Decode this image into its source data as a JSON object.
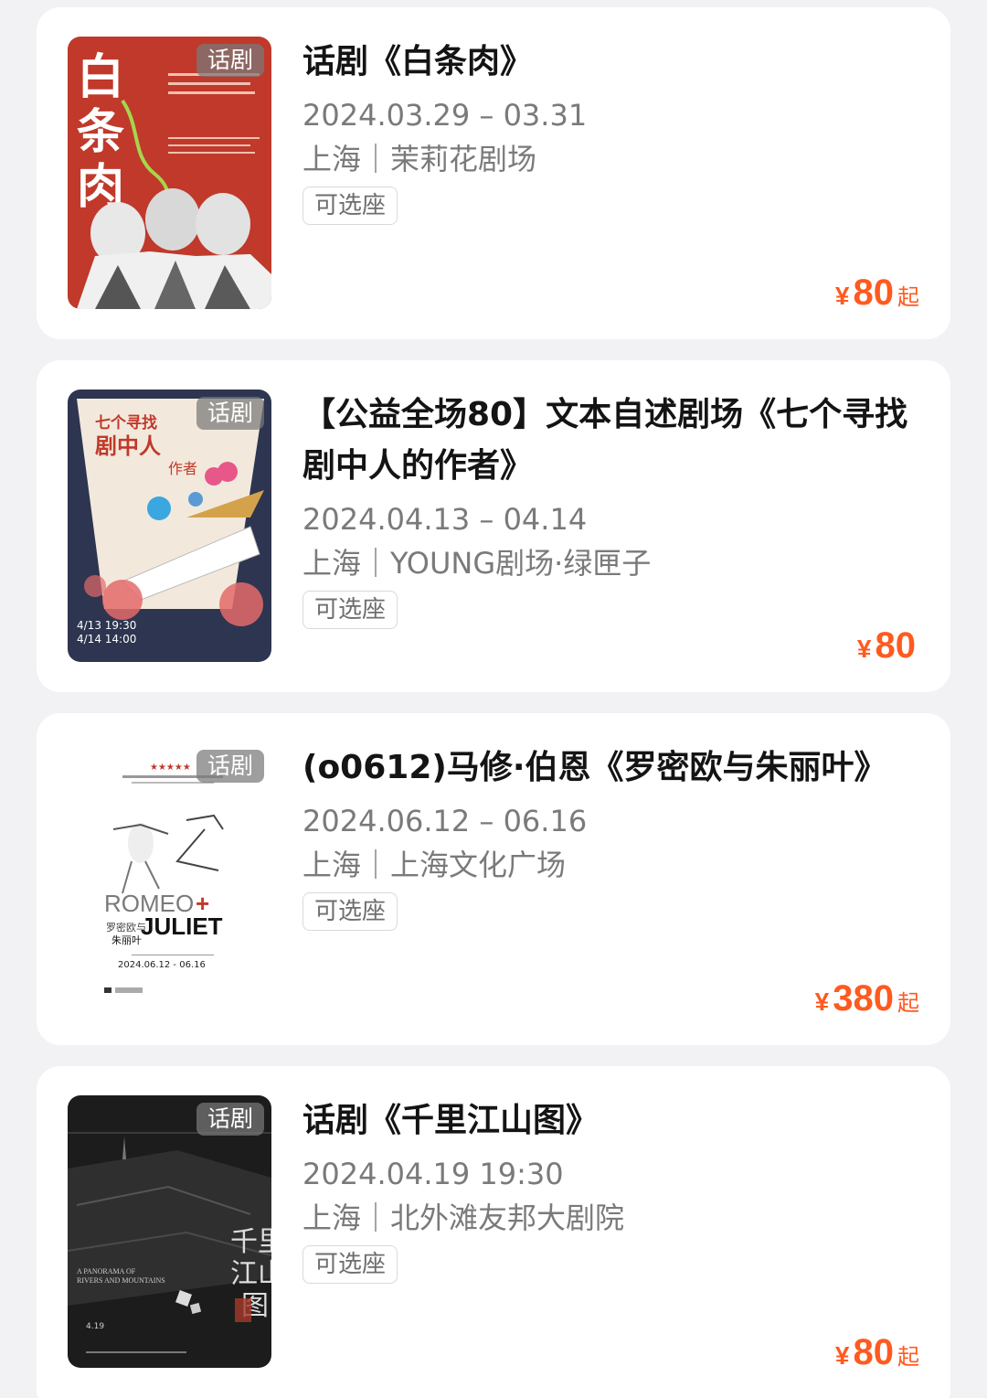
{
  "shows": [
    {
      "tag": "话剧",
      "title": "话剧《白条肉》",
      "date": "2024.03.29 – 03.31",
      "venue": "上海｜茉莉花剧场",
      "seat_label": "可选座",
      "price_currency": "¥",
      "price": "80",
      "price_suffix": "起",
      "poster_text": "白条肉"
    },
    {
      "tag": "话剧",
      "title": "【公益全场80】文本自述剧场《七个寻找剧中人的作者》",
      "date": "2024.04.13 – 04.14",
      "venue": "上海｜YOUNG剧场·绿匣子",
      "seat_label": "可选座",
      "price_currency": "¥",
      "price": "80",
      "price_suffix": "",
      "poster_text": "七个寻找剧中人的作者",
      "poster_dates": "2024 4/13 19:30 4/14 14:00"
    },
    {
      "tag": "话剧",
      "title": "(o0612)马修·伯恩《罗密欧与朱丽叶》",
      "date": "2024.06.12 – 06.16",
      "venue": "上海｜上海文化广场",
      "seat_label": "可选座",
      "price_currency": "¥",
      "price": "380",
      "price_suffix": "起",
      "poster_text": "ROMEO+JULIET",
      "poster_sub": "罗密欧与朱丽叶",
      "poster_dates": "2024.06.12 - 06.16"
    },
    {
      "tag": "话剧",
      "title": "话剧《千里江山图》",
      "date": "2024.04.19 19:30",
      "venue": "上海｜北外滩友邦大剧院",
      "seat_label": "可选座",
      "price_currency": "¥",
      "price": "80",
      "price_suffix": "起",
      "poster_text": "千里江山图",
      "poster_sub": "A PANORAMA OF RIVERS AND MOUNTAINS"
    }
  ],
  "colors": {
    "price": "#ff5a1f",
    "poster1_bg": "#c0392b",
    "poster2_bg": "#2e3550",
    "poster3_bg": "#ffffff",
    "poster4_bg": "#1c1c1c"
  }
}
